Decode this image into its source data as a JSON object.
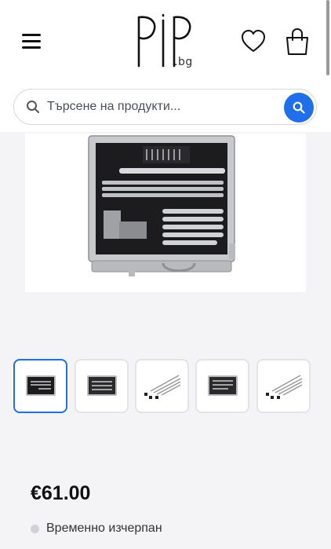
{
  "header": {
    "menu_icon": "hamburger-menu-icon",
    "logo_suffix": ".bg",
    "wishlist_icon": "heart-icon",
    "cart_icon": "shopping-bag-icon"
  },
  "search": {
    "placeholder": "Търсене на продукти...",
    "value": "",
    "submit_icon": "search-icon"
  },
  "gallery": {
    "thumbnails": [
      {
        "active": true
      },
      {
        "active": false
      },
      {
        "active": false
      },
      {
        "active": false
      },
      {
        "active": false
      }
    ]
  },
  "product": {
    "price": "€61.00",
    "stock_status": "Временно изчерпан"
  },
  "colors": {
    "accent": "#1f6feb",
    "background": "#f4f4f6"
  }
}
